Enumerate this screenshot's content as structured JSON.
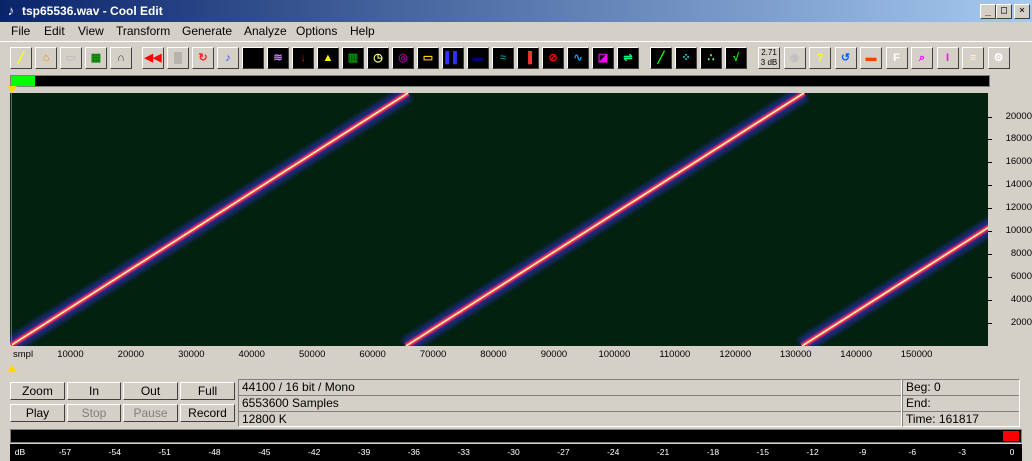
{
  "window": {
    "title": "tsp65536.wav - Cool Edit",
    "app_icon": "app-icon",
    "buttons": [
      "_",
      "□",
      "×"
    ]
  },
  "menu": [
    "File",
    "Edit",
    "View",
    "Transform",
    "Generate",
    "Analyze",
    "Options",
    "Help"
  ],
  "toolbar": {
    "icons": [
      "edit-view-icon",
      "open-icon",
      "save-icon",
      "close-file-icon",
      "headphones-icon",
      "rewind-icon",
      "noise-icon",
      "loop-icon",
      "music-note-icon",
      "black-dot-icon",
      "echo-icon",
      "download-icon",
      "amplitude-icon",
      "waveform-icon",
      "clock-icon",
      "wireless-icon",
      "tape-icon",
      "spectrum-icon",
      "spectral-bars-icon",
      "wave-icon",
      "equalizer-icon",
      "no-sign-icon",
      "sweep-icon",
      "filter-icon",
      "reverse-icon",
      "line-icon",
      "grid-icon",
      "dots-icon",
      "diagonal-icon",
      "level-3db-icon",
      "disc-icon",
      "help-icon",
      "refresh-icon",
      "meter-icon",
      "font-icon",
      "find-icon",
      "marker-icon",
      "notes-icon",
      "settings-icon"
    ],
    "level_label": "2.71 3 dB"
  },
  "status_progress": 0.025,
  "spectrogram": {
    "y_ticks": [
      "20000",
      "18000",
      "16000",
      "14000",
      "12000",
      "10000",
      "8000",
      "6000",
      "4000",
      "2000"
    ],
    "x_unit": "smpl",
    "x_ticks": [
      "10000",
      "20000",
      "30000",
      "40000",
      "50000",
      "60000",
      "70000",
      "80000",
      "90000",
      "100000",
      "110000",
      "120000",
      "130000",
      "140000",
      "150000"
    ]
  },
  "controls": {
    "zoom": "Zoom",
    "in": "In",
    "out": "Out",
    "full": "Full",
    "play": "Play",
    "stop": "Stop",
    "pause": "Pause",
    "record": "Record"
  },
  "info": {
    "format": "44100 / 16 bit / Mono",
    "samples": "6553600 Samples",
    "size": "12800 K"
  },
  "selection": {
    "beg": "Beg: 0",
    "end": "End:",
    "time": "Time: 161817"
  },
  "meter": {
    "unit": "dB",
    "ticks": [
      "-57",
      "-54",
      "-51",
      "-48",
      "-45",
      "-42",
      "-39",
      "-36",
      "-33",
      "-30",
      "-27",
      "-24",
      "-21",
      "-18",
      "-15",
      "-12",
      "-9",
      "-6",
      "-3",
      "0"
    ]
  }
}
